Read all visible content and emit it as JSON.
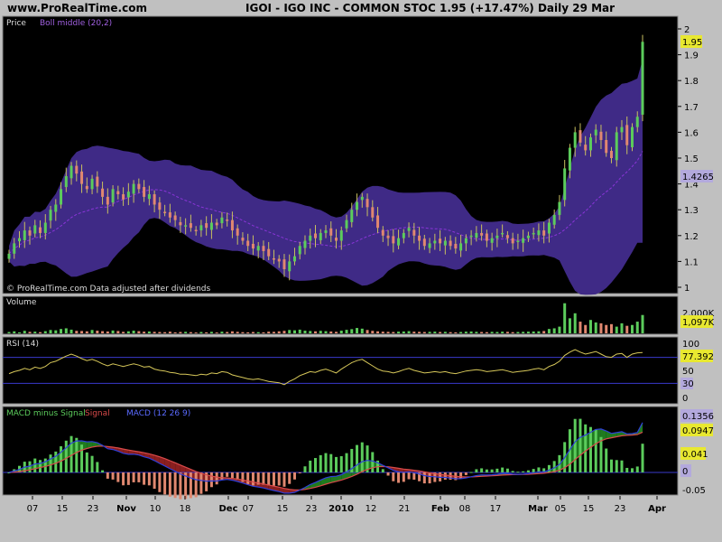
{
  "header": {
    "site": "www.ProRealTime.com",
    "title": "IGOI - IGO  INC - COMMON STOC    1.95 (+17.47%)    Daily  29 Mar"
  },
  "price_panel": {
    "label": "Price",
    "indicator": "Boll middle (20,2)",
    "footnote": "© ProRealTime.com  Data adjusted after dividends",
    "last_badge": "1.95",
    "mid_badge": "1.4265",
    "ticks": [
      "2",
      "1.9",
      "1.8",
      "1.7",
      "1.6",
      "1.5",
      "1.4",
      "1.3",
      "1.2",
      "1.1",
      "1"
    ]
  },
  "volume_panel": {
    "label": "Volume",
    "tick": "2,000K",
    "badge": "1,097K"
  },
  "rsi_panel": {
    "label": "RSI (14)",
    "ticks": [
      "100",
      "50",
      "0"
    ],
    "badge_value": "77.392",
    "badge_level": "30"
  },
  "macd_panel": {
    "label_hist": "MACD minus Signal",
    "label_signal": "Signal",
    "label_macd": "MACD (12 26 9)",
    "badges": [
      "0.1356",
      "0.0947",
      "0.041",
      "0"
    ],
    "tick_bottom": "-0.05"
  },
  "x_axis": {
    "labels": [
      "07",
      "15",
      "23",
      "Nov",
      "10",
      "18",
      "Dec",
      "07",
      "15",
      "23",
      "2010",
      "12",
      "21",
      "Feb",
      "08",
      "17",
      "Mar",
      "05",
      "15",
      "23",
      "Apr"
    ]
  },
  "colors": {
    "up": "#5ccc5c",
    "down": "#e08870",
    "band": "#3f2a86",
    "boll_mid": "#8a35d8",
    "rsi_line": "#d7c85a",
    "rsi_level": "#3a3acc",
    "macd_line": "#2f3fd8",
    "signal_line": "#d84a4a"
  },
  "chart_data": {
    "type": "candlestick",
    "dates": [
      "Oct 01",
      "Oct 02",
      "Oct 05",
      "Oct 06",
      "Oct 07",
      "Oct 08",
      "Oct 09",
      "Oct 12",
      "Oct 13",
      "Oct 14",
      "Oct 15",
      "Oct 16",
      "Oct 19",
      "Oct 20",
      "Oct 21",
      "Oct 22",
      "Oct 23",
      "Oct 26",
      "Oct 27",
      "Oct 28",
      "Oct 29",
      "Oct 30",
      "Nov 02",
      "Nov 03",
      "Nov 04",
      "Nov 05",
      "Nov 06",
      "Nov 09",
      "Nov 10",
      "Nov 11",
      "Nov 12",
      "Nov 13",
      "Nov 16",
      "Nov 17",
      "Nov 18",
      "Nov 19",
      "Nov 20",
      "Nov 23",
      "Nov 24",
      "Nov 25",
      "Nov 27",
      "Nov 30",
      "Dec 01",
      "Dec 02",
      "Dec 03",
      "Dec 04",
      "Dec 07",
      "Dec 08",
      "Dec 09",
      "Dec 10",
      "Dec 11",
      "Dec 14",
      "Dec 15",
      "Dec 16",
      "Dec 17",
      "Dec 18",
      "Dec 21",
      "Dec 22",
      "Dec 23",
      "Dec 24",
      "Dec 28",
      "Dec 29",
      "Dec 30",
      "Dec 31",
      "Jan 04",
      "Jan 05",
      "Jan 06",
      "Jan 07",
      "Jan 08",
      "Jan 11",
      "Jan 12",
      "Jan 13",
      "Jan 14",
      "Jan 15",
      "Jan 19",
      "Jan 20",
      "Jan 21",
      "Jan 22",
      "Jan 25",
      "Jan 26",
      "Jan 27",
      "Jan 28",
      "Jan 29",
      "Feb 01",
      "Feb 02",
      "Feb 03",
      "Feb 04",
      "Feb 05",
      "Feb 08",
      "Feb 09",
      "Feb 10",
      "Feb 11",
      "Feb 12",
      "Feb 16",
      "Feb 17",
      "Feb 18",
      "Feb 19",
      "Feb 22",
      "Feb 23",
      "Feb 24",
      "Feb 25",
      "Feb 26",
      "Mar 01",
      "Mar 02",
      "Mar 03",
      "Mar 04",
      "Mar 05",
      "Mar 08",
      "Mar 09",
      "Mar 10",
      "Mar 11",
      "Mar 12",
      "Mar 15",
      "Mar 16",
      "Mar 17",
      "Mar 18",
      "Mar 19",
      "Mar 22",
      "Mar 23",
      "Mar 24",
      "Mar 25",
      "Mar 26",
      "Mar 29"
    ],
    "close": [
      1.13,
      1.17,
      1.19,
      1.22,
      1.2,
      1.24,
      1.21,
      1.25,
      1.3,
      1.32,
      1.38,
      1.43,
      1.47,
      1.44,
      1.4,
      1.38,
      1.42,
      1.39,
      1.35,
      1.32,
      1.38,
      1.36,
      1.34,
      1.37,
      1.4,
      1.38,
      1.35,
      1.36,
      1.32,
      1.3,
      1.29,
      1.27,
      1.26,
      1.24,
      1.24,
      1.23,
      1.22,
      1.24,
      1.23,
      1.25,
      1.24,
      1.27,
      1.26,
      1.22,
      1.2,
      1.18,
      1.16,
      1.15,
      1.16,
      1.14,
      1.12,
      1.11,
      1.1,
      1.07,
      1.1,
      1.12,
      1.16,
      1.18,
      1.2,
      1.19,
      1.21,
      1.22,
      1.2,
      1.18,
      1.22,
      1.26,
      1.3,
      1.33,
      1.35,
      1.31,
      1.27,
      1.23,
      1.2,
      1.19,
      1.17,
      1.19,
      1.21,
      1.23,
      1.2,
      1.18,
      1.16,
      1.17,
      1.18,
      1.17,
      1.18,
      1.16,
      1.15,
      1.17,
      1.19,
      1.2,
      1.21,
      1.2,
      1.18,
      1.19,
      1.2,
      1.21,
      1.19,
      1.17,
      1.18,
      1.19,
      1.2,
      1.21,
      1.22,
      1.2,
      1.25,
      1.28,
      1.33,
      1.46,
      1.54,
      1.6,
      1.56,
      1.53,
      1.58,
      1.61,
      1.57,
      1.52,
      1.5,
      1.6,
      1.62,
      1.55,
      1.62,
      1.66,
      1.95
    ],
    "volume_k": [
      80,
      120,
      60,
      150,
      90,
      100,
      70,
      130,
      200,
      180,
      260,
      300,
      220,
      150,
      140,
      120,
      200,
      160,
      130,
      110,
      170,
      140,
      90,
      120,
      160,
      130,
      100,
      110,
      90,
      80,
      70,
      100,
      60,
      80,
      90,
      70,
      50,
      80,
      60,
      90,
      50,
      100,
      80,
      120,
      90,
      70,
      60,
      80,
      70,
      60,
      100,
      90,
      120,
      150,
      200,
      180,
      220,
      160,
      140,
      120,
      150,
      130,
      110,
      90,
      160,
      210,
      250,
      320,
      280,
      200,
      150,
      120,
      100,
      90,
      80,
      100,
      110,
      130,
      100,
      90,
      80,
      90,
      100,
      80,
      90,
      70,
      60,
      80,
      100,
      110,
      90,
      80,
      70,
      90,
      80,
      100,
      90,
      70,
      80,
      90,
      100,
      110,
      120,
      140,
      260,
      300,
      400,
      1800,
      900,
      1200,
      700,
      500,
      800,
      650,
      600,
      500,
      550,
      400,
      600,
      450,
      500,
      700,
      1097
    ],
    "rsi": [
      45,
      48,
      50,
      53,
      51,
      55,
      53,
      56,
      62,
      64,
      68,
      72,
      75,
      72,
      68,
      65,
      67,
      64,
      60,
      57,
      60,
      58,
      56,
      58,
      60,
      58,
      55,
      56,
      52,
      50,
      49,
      47,
      46,
      44,
      44,
      43,
      42,
      44,
      43,
      46,
      45,
      48,
      47,
      43,
      41,
      39,
      37,
      36,
      37,
      35,
      33,
      32,
      31,
      28,
      33,
      37,
      42,
      45,
      48,
      47,
      50,
      52,
      49,
      46,
      52,
      57,
      62,
      65,
      67,
      62,
      57,
      52,
      49,
      48,
      46,
      48,
      51,
      53,
      50,
      48,
      46,
      47,
      48,
      47,
      48,
      46,
      45,
      47,
      49,
      50,
      51,
      50,
      48,
      49,
      50,
      51,
      49,
      47,
      48,
      49,
      50,
      52,
      53,
      51,
      56,
      59,
      64,
      73,
      78,
      82,
      78,
      75,
      77,
      79,
      75,
      71,
      70,
      75,
      76,
      70,
      75,
      77,
      77.392
    ],
    "ylim_price": [
      1.0,
      2.0
    ],
    "rsi_levels": [
      30,
      70
    ],
    "macd_range": [
      -0.05,
      0.15
    ]
  }
}
